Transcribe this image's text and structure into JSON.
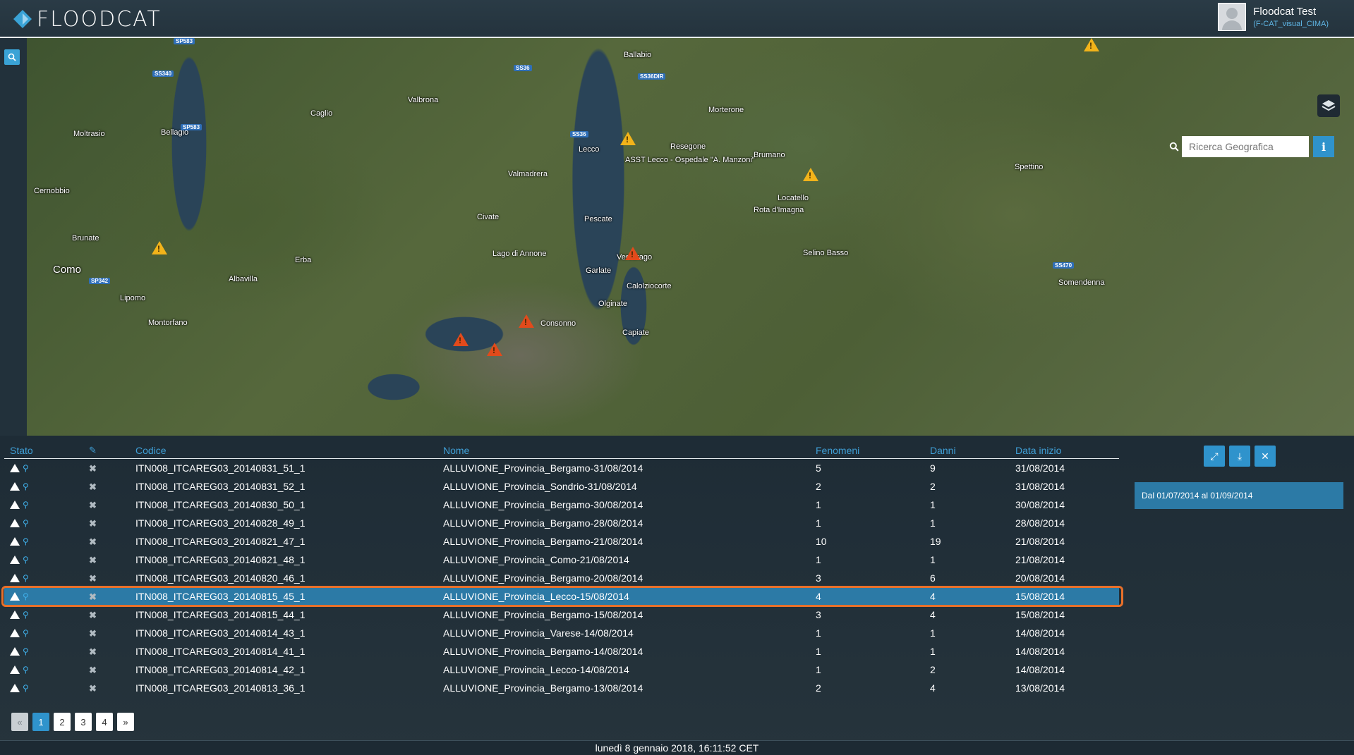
{
  "app": {
    "logo_text": "FLOODCAT",
    "user_name": "Floodcat Test",
    "user_sub": "(F-CAT_visual_CIMA)"
  },
  "map": {
    "search_placeholder": "Ricerca Geografica",
    "info_label": "i",
    "places": [
      {
        "label": "Como",
        "big": true
      },
      {
        "label": "Lecco",
        "big": false
      },
      {
        "label": "Cernobbio",
        "big": false
      },
      {
        "label": "Erba",
        "big": false
      },
      {
        "label": "Valmadrera",
        "big": false
      },
      {
        "label": "Lago di Annone",
        "big": false
      },
      {
        "label": "Calolziocorte",
        "big": false
      },
      {
        "label": "Consonno",
        "big": false
      },
      {
        "label": "ASST Lecco - Ospedale \"A. Manzoni\"",
        "big": false
      },
      {
        "label": "Resegone",
        "big": false
      },
      {
        "label": "Ballabio",
        "big": false
      },
      {
        "label": "Morterone",
        "big": false
      },
      {
        "label": "Brumano",
        "big": false
      },
      {
        "label": "Locatello",
        "big": false
      },
      {
        "label": "Bellagio",
        "big": false
      },
      {
        "label": "Civate",
        "big": false
      },
      {
        "label": "Olginate",
        "big": false
      },
      {
        "label": "Valbrona",
        "big": false
      },
      {
        "label": "Caglio",
        "big": false
      },
      {
        "label": "Albavilla",
        "big": false
      },
      {
        "label": "Montorfano",
        "big": false
      },
      {
        "label": "Lipomo",
        "big": false
      },
      {
        "label": "Brunate",
        "big": false
      },
      {
        "label": "Moltrasio",
        "big": false
      },
      {
        "label": "Capiate",
        "big": false
      },
      {
        "label": "Garlate",
        "big": false
      },
      {
        "label": "Pescate",
        "big": false
      },
      {
        "label": "Vercurago",
        "big": false
      },
      {
        "label": "Rota d'Imagna",
        "big": false
      },
      {
        "label": "Selino Basso",
        "big": false
      },
      {
        "label": "Spettino",
        "big": false
      },
      {
        "label": "Somendenna",
        "big": false
      }
    ],
    "roads": [
      "SP583",
      "SS340",
      "SS36",
      "SS36DIR",
      "SP342",
      "SS470",
      "SP583",
      "SS36"
    ]
  },
  "table": {
    "headers": {
      "stato": "Stato",
      "codice": "Codice",
      "nome": "Nome",
      "fenomeni": "Fenomeni",
      "danni": "Danni",
      "data_inizio": "Data inizio"
    },
    "rows": [
      {
        "codice": "ITN008_ITCAREG03_20140831_51_1",
        "nome": "ALLUVIONE_Provincia_Bergamo-31/08/2014",
        "fenomeni": "5",
        "danni": "9",
        "data": "31/08/2014"
      },
      {
        "codice": "ITN008_ITCAREG03_20140831_52_1",
        "nome": "ALLUVIONE_Provincia_Sondrio-31/08/2014",
        "fenomeni": "2",
        "danni": "2",
        "data": "31/08/2014"
      },
      {
        "codice": "ITN008_ITCAREG03_20140830_50_1",
        "nome": "ALLUVIONE_Provincia_Bergamo-30/08/2014",
        "fenomeni": "1",
        "danni": "1",
        "data": "30/08/2014"
      },
      {
        "codice": "ITN008_ITCAREG03_20140828_49_1",
        "nome": "ALLUVIONE_Provincia_Bergamo-28/08/2014",
        "fenomeni": "1",
        "danni": "1",
        "data": "28/08/2014"
      },
      {
        "codice": "ITN008_ITCAREG03_20140821_47_1",
        "nome": "ALLUVIONE_Provincia_Bergamo-21/08/2014",
        "fenomeni": "10",
        "danni": "19",
        "data": "21/08/2014"
      },
      {
        "codice": "ITN008_ITCAREG03_20140821_48_1",
        "nome": "ALLUVIONE_Provincia_Como-21/08/2014",
        "fenomeni": "1",
        "danni": "1",
        "data": "21/08/2014"
      },
      {
        "codice": "ITN008_ITCAREG03_20140820_46_1",
        "nome": "ALLUVIONE_Provincia_Bergamo-20/08/2014",
        "fenomeni": "3",
        "danni": "6",
        "data": "20/08/2014"
      },
      {
        "codice": "ITN008_ITCAREG03_20140815_45_1",
        "nome": "ALLUVIONE_Provincia_Lecco-15/08/2014",
        "fenomeni": "4",
        "danni": "4",
        "data": "15/08/2014",
        "selected": true
      },
      {
        "codice": "ITN008_ITCAREG03_20140815_44_1",
        "nome": "ALLUVIONE_Provincia_Bergamo-15/08/2014",
        "fenomeni": "3",
        "danni": "4",
        "data": "15/08/2014"
      },
      {
        "codice": "ITN008_ITCAREG03_20140814_43_1",
        "nome": "ALLUVIONE_Provincia_Varese-14/08/2014",
        "fenomeni": "1",
        "danni": "1",
        "data": "14/08/2014"
      },
      {
        "codice": "ITN008_ITCAREG03_20140814_41_1",
        "nome": "ALLUVIONE_Provincia_Bergamo-14/08/2014",
        "fenomeni": "1",
        "danni": "1",
        "data": "14/08/2014"
      },
      {
        "codice": "ITN008_ITCAREG03_20140814_42_1",
        "nome": "ALLUVIONE_Provincia_Lecco-14/08/2014",
        "fenomeni": "1",
        "danni": "2",
        "data": "14/08/2014"
      },
      {
        "codice": "ITN008_ITCAREG03_20140813_36_1",
        "nome": "ALLUVIONE_Provincia_Bergamo-13/08/2014",
        "fenomeni": "2",
        "danni": "4",
        "data": "13/08/2014"
      }
    ]
  },
  "filters": {
    "date_range": "Dal 01/07/2014 al 01/09/2014"
  },
  "pagination": {
    "prev": "«",
    "pages": [
      "1",
      "2",
      "3",
      "4"
    ],
    "active": "1",
    "next": "»"
  },
  "footer": {
    "datetime": "lunedì 8 gennaio 2018, 16:11:52 CET"
  },
  "colors": {
    "accent": "#2f93cc",
    "header_text": "#3f9fd6",
    "selection_outline": "#e8702a",
    "warning": "#f2b31a",
    "alert": "#e24a1b"
  }
}
